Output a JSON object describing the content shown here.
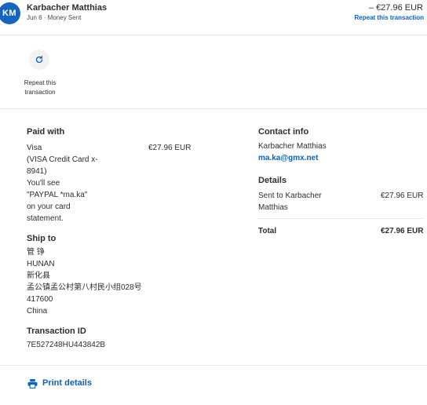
{
  "header": {
    "avatar_initials": "KM",
    "name": "Karbacher Matthias",
    "subtitle": "Jun 6 · Money Sent",
    "amount": "– €27.96 EUR",
    "repeat_link": "Repeat this transaction"
  },
  "repeat_action": {
    "label_line1": "Repeat this",
    "label_line2": "transaction",
    "icon": "refresh-icon"
  },
  "paid_with": {
    "title": "Paid with",
    "lines": [
      "Visa",
      "(VISA Credit Card x-",
      "8941)",
      "You'll see",
      "\"PAYPAL *ma.ka\"",
      "on your card",
      "statement."
    ],
    "amount": "€27.96 EUR"
  },
  "ship_to": {
    "title": "Ship to",
    "lines": [
      "管 铮",
      "HUNAN",
      "新化县",
      "孟公镇孟公村第八村民小组028号",
      "417600",
      "China"
    ]
  },
  "transaction": {
    "title": "Transaction ID",
    "id": "7E527248HU443842B"
  },
  "contact": {
    "title": "Contact info",
    "name": "Karbacher Matthias",
    "email": "ma.ka@gmx.net"
  },
  "details": {
    "title": "Details",
    "sent_line1": "Sent to Karbacher",
    "sent_line2": "Matthias",
    "sent_amount": "€27.96 EUR",
    "total_label": "Total",
    "total_amount": "€27.96 EUR"
  },
  "footer": {
    "print_label": "Print details",
    "icon": "printer-icon"
  },
  "colors": {
    "accent": "#0b62c4",
    "avatar": "#1565c0",
    "text": "#2c2e2f",
    "divider": "#e6e6e6"
  }
}
